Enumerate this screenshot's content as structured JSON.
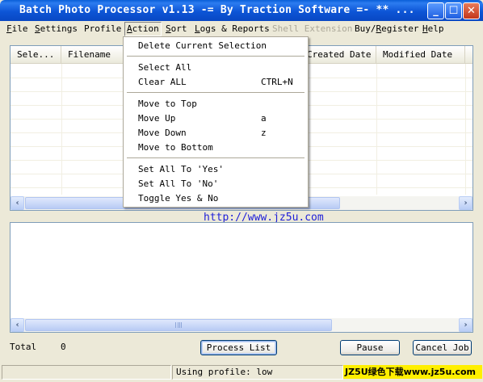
{
  "window": {
    "title": "Batch Photo Processor v1.13  -= By Traction Software =- ** ..."
  },
  "menubar": {
    "items": [
      {
        "label": "File",
        "key": "F"
      },
      {
        "label": "Settings",
        "key": "S"
      },
      {
        "label": "Profile",
        "key": ""
      },
      {
        "label": "Action",
        "key": "A"
      },
      {
        "label": "Sort",
        "key": "S"
      },
      {
        "label": "Logs & Reports",
        "key": "L"
      },
      {
        "label": "Shell Extension",
        "key": "",
        "disabled": true
      },
      {
        "label": "Buy/Register",
        "key": "R"
      },
      {
        "label": "Help",
        "key": "H"
      }
    ]
  },
  "action_menu": {
    "items": [
      {
        "label": "Delete Current Selection",
        "shortcut": ""
      },
      {
        "label": "Select All",
        "shortcut": ""
      },
      {
        "label": "Clear ALL",
        "shortcut": "CTRL+N"
      },
      {
        "label": "Move to Top",
        "shortcut": ""
      },
      {
        "label": "Move Up",
        "shortcut": "a"
      },
      {
        "label": "Move Down",
        "shortcut": "z"
      },
      {
        "label": "Move to Bottom",
        "shortcut": ""
      },
      {
        "label": "Set All To 'Yes'",
        "shortcut": ""
      },
      {
        "label": "Set All To 'No'",
        "shortcut": ""
      },
      {
        "label": "Toggle Yes & No",
        "shortcut": ""
      }
    ]
  },
  "file_list": {
    "columns": [
      "Sele...",
      "Filename",
      "Created Date",
      "Modified Date"
    ]
  },
  "url_text": "http://www.jz5u.com",
  "status": {
    "total_label": "Total",
    "total_value": "0",
    "profile_text": "Using profile: low"
  },
  "buttons": {
    "process_list": "Process List",
    "pause": "Pause",
    "cancel_job": "Cancel Job"
  },
  "watermark": "JZ5U绿色下载www.jz5u.com",
  "colors": {
    "titlebar": "#0a5fd8",
    "url": "#2020d8",
    "watermark_bg": "#ffef00"
  },
  "icons": [
    "minimize-icon",
    "maximize-icon",
    "close-icon",
    "scroll-left-icon",
    "scroll-right-icon"
  ]
}
